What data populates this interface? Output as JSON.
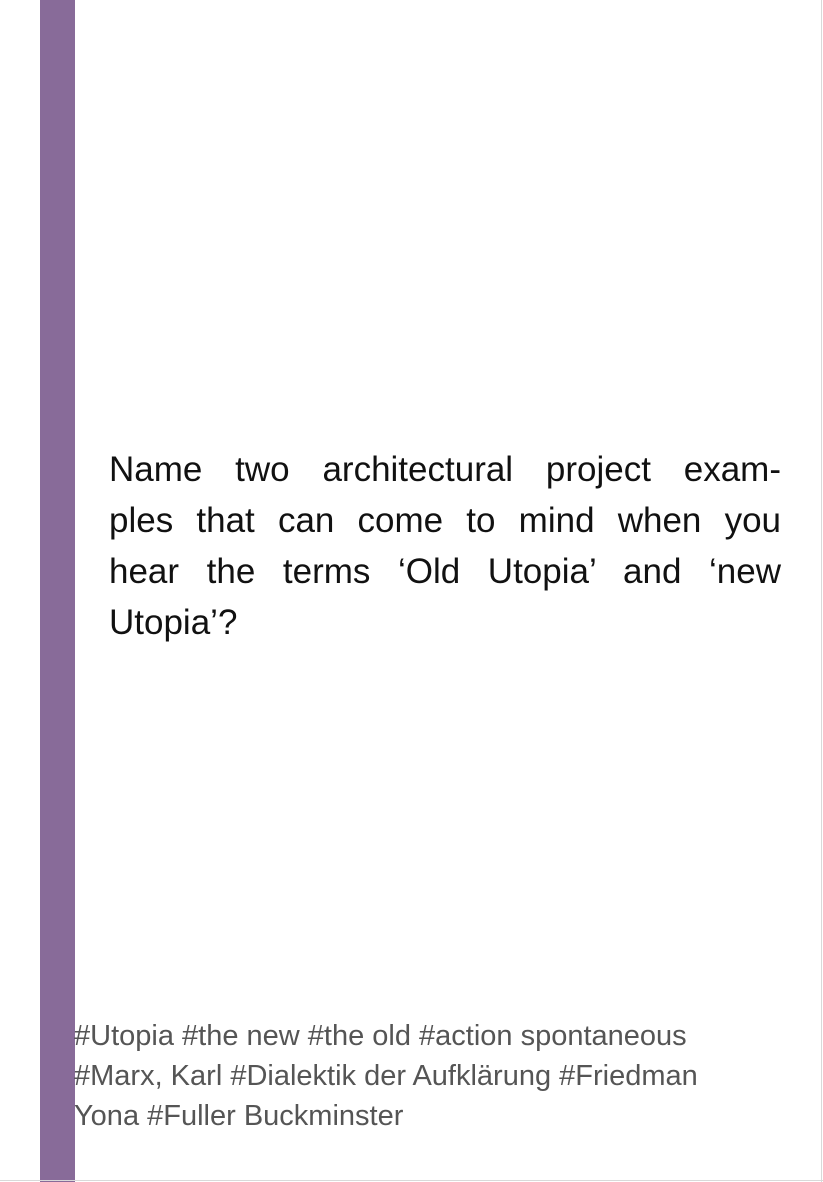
{
  "card": {
    "accent_color": "#886b99",
    "question_lines": [
      "Name two architectural project exam-",
      "ples that can come to mind when you",
      "hear the terms ‘Old Utopia’ and ‘new",
      "Utopia’?"
    ],
    "tag_lines": [
      "#Utopia #the new #the old #action spontaneous",
      "#Marx, Karl #Dialektik der Aufklärung #Friedman",
      "Yona #Fuller Buckminster"
    ]
  }
}
